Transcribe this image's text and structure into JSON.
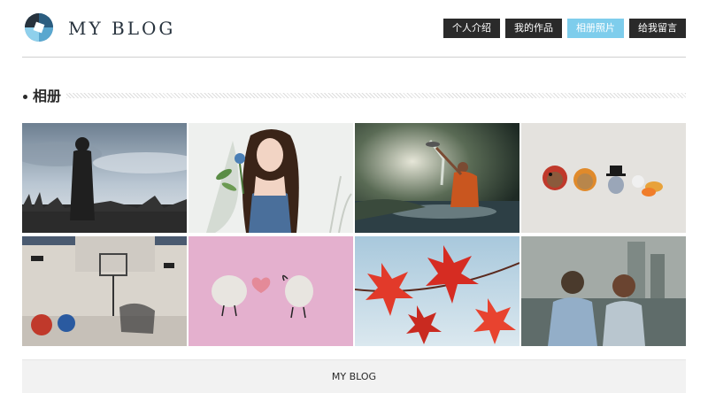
{
  "header": {
    "site_title": "MY BLOG",
    "logo_icon": "aperture-logo-icon",
    "accent_color": "#7ecdec",
    "nav": [
      {
        "label": "个人介绍",
        "active": false
      },
      {
        "label": "我的作品",
        "active": false
      },
      {
        "label": "相册照片",
        "active": true
      },
      {
        "label": "给我留言",
        "active": false
      }
    ]
  },
  "section": {
    "title": "相册"
  },
  "gallery": {
    "photos": [
      {
        "subject": "silhouette-in-grass"
      },
      {
        "subject": "girl-with-flower"
      },
      {
        "subject": "man-splashing-water"
      },
      {
        "subject": "felt-turkeys"
      },
      {
        "subject": "street-graffiti-basketball"
      },
      {
        "subject": "stones-with-heart"
      },
      {
        "subject": "red-maple-leaves"
      },
      {
        "subject": "couple-by-river"
      }
    ]
  },
  "footer": {
    "text": "MY BLOG"
  }
}
